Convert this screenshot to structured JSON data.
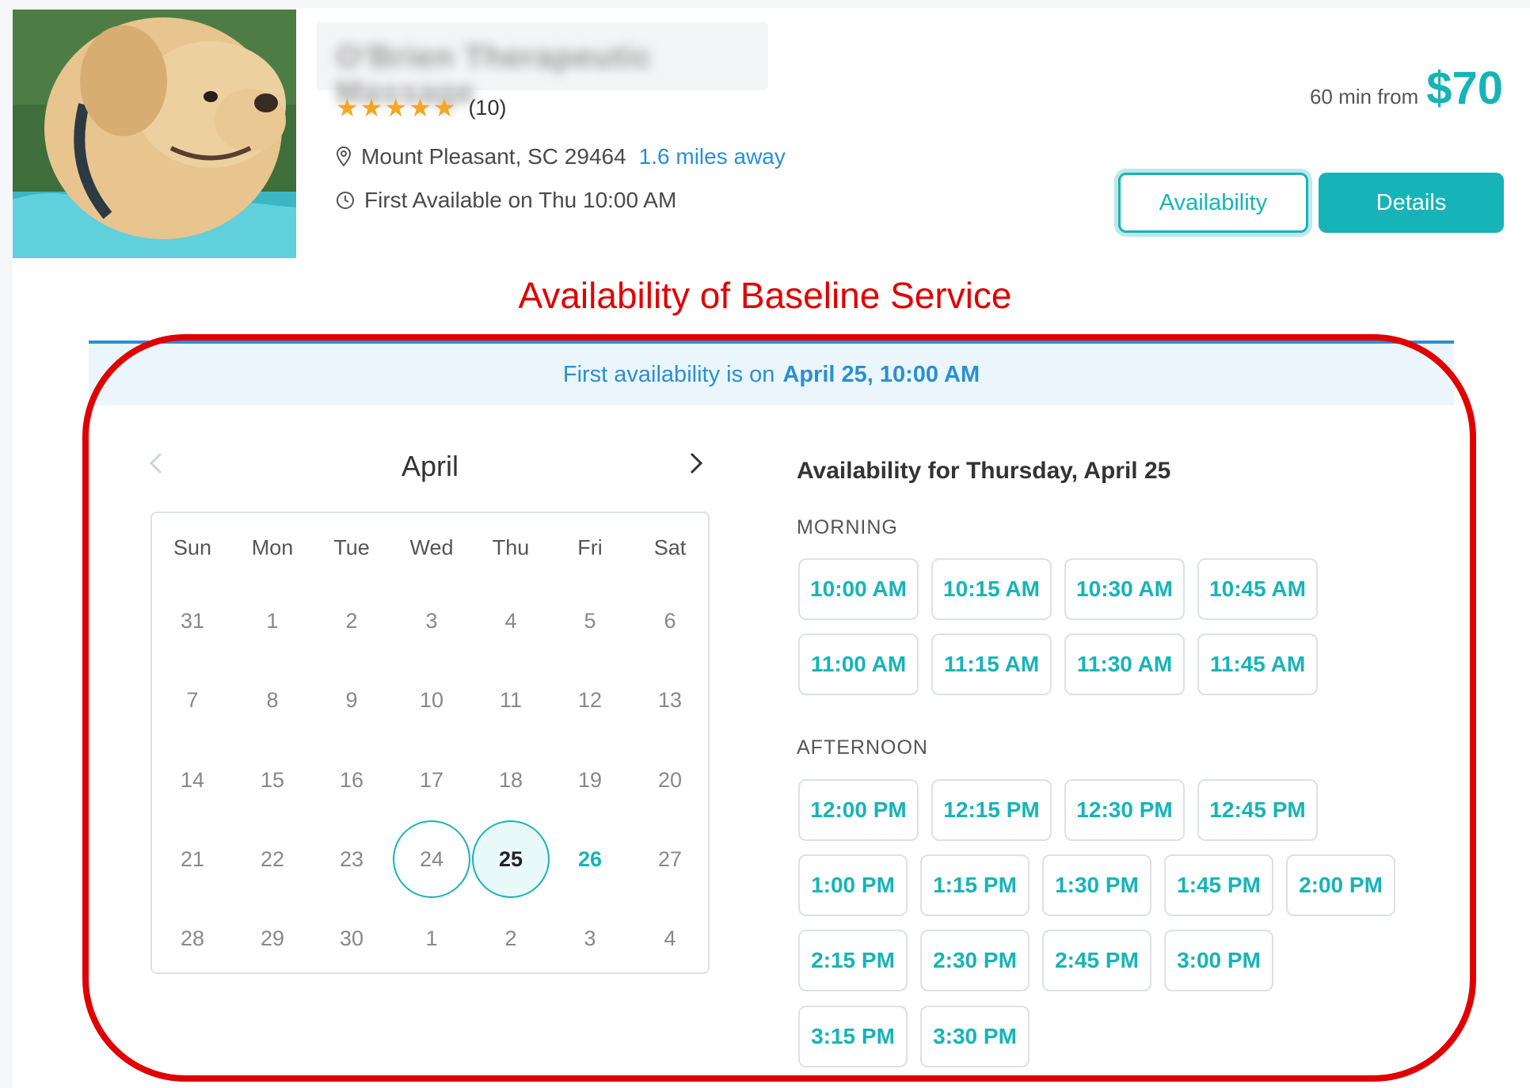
{
  "listing": {
    "title": "O'Brien Therapeutic Massage",
    "rating_count": "(10)",
    "location": "Mount Pleasant, SC 29464",
    "distance": "1.6 miles away",
    "first_available": "First Available on Thu 10:00 AM",
    "price_prefix": "60 min from",
    "price": "$70",
    "availability_button": "Availability",
    "details_button": "Details"
  },
  "annotation": "Availability of Baseline Service",
  "banner": {
    "prefix": "First availability is on",
    "date": "April 25, 10:00 AM"
  },
  "calendar": {
    "month": "April",
    "weekdays": [
      "Sun",
      "Mon",
      "Tue",
      "Wed",
      "Thu",
      "Fri",
      "Sat"
    ],
    "weeks": [
      [
        "31",
        "1",
        "2",
        "3",
        "4",
        "5",
        "6"
      ],
      [
        "7",
        "8",
        "9",
        "10",
        "11",
        "12",
        "13"
      ],
      [
        "14",
        "15",
        "16",
        "17",
        "18",
        "19",
        "20"
      ],
      [
        "21",
        "22",
        "23",
        "24",
        "25",
        "26",
        "27"
      ],
      [
        "28",
        "29",
        "30",
        "1",
        "2",
        "3",
        "4"
      ]
    ],
    "today": "24",
    "selected": "25",
    "available": [
      "26"
    ]
  },
  "availability": {
    "title": "Availability for Thursday, April 25",
    "morning_label": "MORNING",
    "afternoon_label": "AFTERNOON",
    "morning": [
      [
        "10:00 AM",
        "10:15 AM",
        "10:30 AM",
        "10:45 AM"
      ],
      [
        "11:00 AM",
        "11:15 AM",
        "11:30 AM",
        "11:45 AM"
      ]
    ],
    "afternoon": [
      [
        "12:00 PM",
        "12:15 PM",
        "12:30 PM",
        "12:45 PM"
      ],
      [
        "1:00 PM",
        "1:15 PM",
        "1:30 PM",
        "1:45 PM",
        "2:00 PM"
      ],
      [
        "2:15 PM",
        "2:30 PM",
        "2:45 PM",
        "3:00 PM"
      ],
      [
        "3:15 PM",
        "3:30 PM"
      ]
    ]
  },
  "colors": {
    "accent": "#16b4b8",
    "link": "#2a8fd4",
    "annotation_red": "#e00000",
    "star": "#f5a623"
  }
}
